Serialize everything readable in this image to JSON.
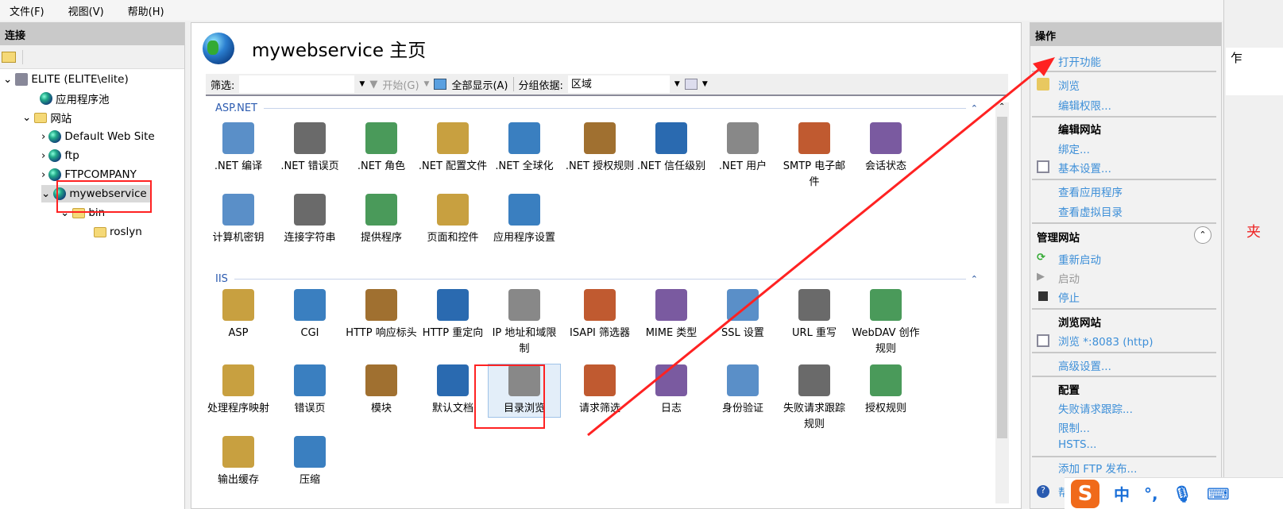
{
  "menu": [
    "文件(F)",
    "视图(V)",
    "帮助(H)"
  ],
  "connections": {
    "title": "连接",
    "tree": [
      {
        "label": "ELITE (ELITE\\elite)",
        "icon": "server-icon"
      },
      {
        "label": "应用程序池",
        "icon": "app-pool-icon"
      },
      {
        "label": "网站",
        "icon": "sites-folder-icon"
      },
      {
        "label": "Default Web Site",
        "icon": "globe-icon"
      },
      {
        "label": "ftp",
        "icon": "globe-icon"
      },
      {
        "label": "FTPCOMPANY",
        "icon": "globe-icon"
      },
      {
        "label": "mywebservice",
        "icon": "globe-icon",
        "selected": true
      },
      {
        "label": "bin",
        "icon": "folder-icon"
      },
      {
        "label": "roslyn",
        "icon": "folder-icon"
      }
    ]
  },
  "main": {
    "title": "mywebservice 主页",
    "filter_label": "筛选:",
    "filter_value": "",
    "go_label": "开始(G)",
    "show_all_label": "全部显示(A)",
    "group_by_label": "分组依据:",
    "group_by_value": "区域",
    "sections": [
      {
        "name": "ASP.NET",
        "features": [
          ".NET 编译",
          ".NET 错误页",
          ".NET 角色",
          ".NET 配置文件",
          ".NET 全球化",
          ".NET 授权规则",
          ".NET 信任级别",
          ".NET 用户",
          "SMTP 电子邮件",
          "会话状态",
          "计算机密钥",
          "连接字符串",
          "提供程序",
          "页面和控件",
          "应用程序设置"
        ]
      },
      {
        "name": "IIS",
        "features": [
          "ASP",
          "CGI",
          "HTTP 响应标头",
          "HTTP 重定向",
          "IP 地址和域限制",
          "ISAPI 筛选器",
          "MIME 类型",
          "SSL 设置",
          "URL 重写",
          "WebDAV 创作规则",
          "处理程序映射",
          "错误页",
          "模块",
          "默认文档",
          "目录浏览",
          "请求筛选",
          "日志",
          "身份验证",
          "失败请求跟踪规则",
          "授权规则",
          "输出缓存",
          "压缩"
        ]
      }
    ]
  },
  "actions": {
    "title": "操作",
    "open_feature": "打开功能",
    "explore": "浏览",
    "edit_permissions": "编辑权限...",
    "edit_site_heading": "编辑网站",
    "bindings": "绑定...",
    "basic_settings": "基本设置...",
    "view_applications": "查看应用程序",
    "view_virtual_dirs": "查看虚拟目录",
    "manage_site_heading": "管理网站",
    "restart": "重新启动",
    "start": "启动",
    "stop": "停止",
    "browse_site_heading": "浏览网站",
    "browse_8083": "浏览 *:8083 (http)",
    "advanced_settings": "高级设置...",
    "config_heading": "配置",
    "failed_request_tracing": "失败请求跟踪...",
    "limits": "限制...",
    "hsts": "HSTS...",
    "add_ftp_publish": "添加 FTP 发布...",
    "help": "帮助"
  },
  "background_window": {
    "partial_text_1": "乍",
    "partial_text_2": "夹"
  },
  "ime": {
    "logo": "S",
    "mode": "中",
    "punct": "°,"
  },
  "colors": {
    "link": "#3d8fd8",
    "annotation": "#ff2222",
    "group_header": "#2c5bb0"
  }
}
